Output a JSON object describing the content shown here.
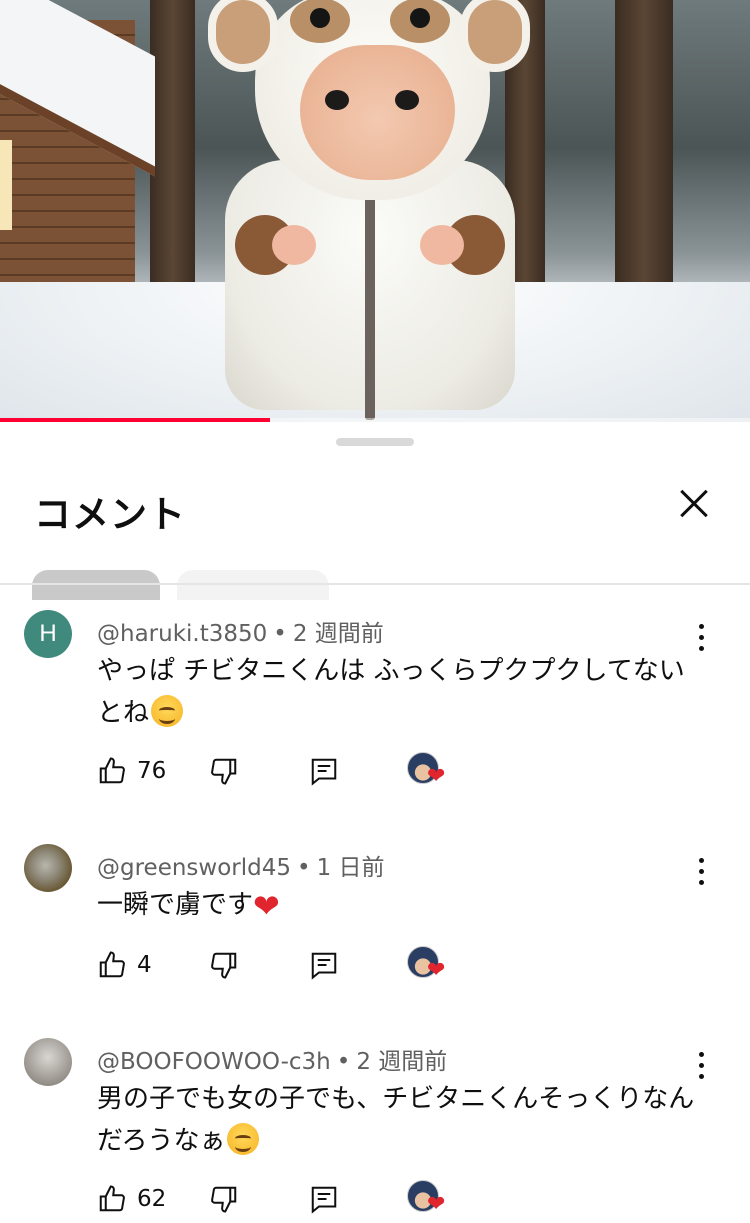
{
  "video": {
    "progress": 0.36,
    "accent": "#ff0033"
  },
  "sheet": {
    "title": "コメント",
    "close_icon": "close-icon"
  },
  "comments": [
    {
      "avatar_letter": "H",
      "author": "@haruki.t3850",
      "time": "2 週間前",
      "text": "やっぱ チビタニくんは ふっくらプクプクしてないとね",
      "emoji": "smiling-face",
      "likes": "76"
    },
    {
      "avatar_letter": "",
      "author": "@greensworld45",
      "time": "1 日前",
      "text": "一瞬で虜です",
      "emoji": "red-heart",
      "likes": "4"
    },
    {
      "avatar_letter": "",
      "author": "@BOOFOOWOO-c3h",
      "time": "2 週間前",
      "text": "男の子でも女の子でも、チビタニくんそっくりなんだろうなぁ",
      "emoji": "smiling-face",
      "likes": "62"
    }
  ],
  "meta_separator": "•",
  "heart_glyph": "❤"
}
